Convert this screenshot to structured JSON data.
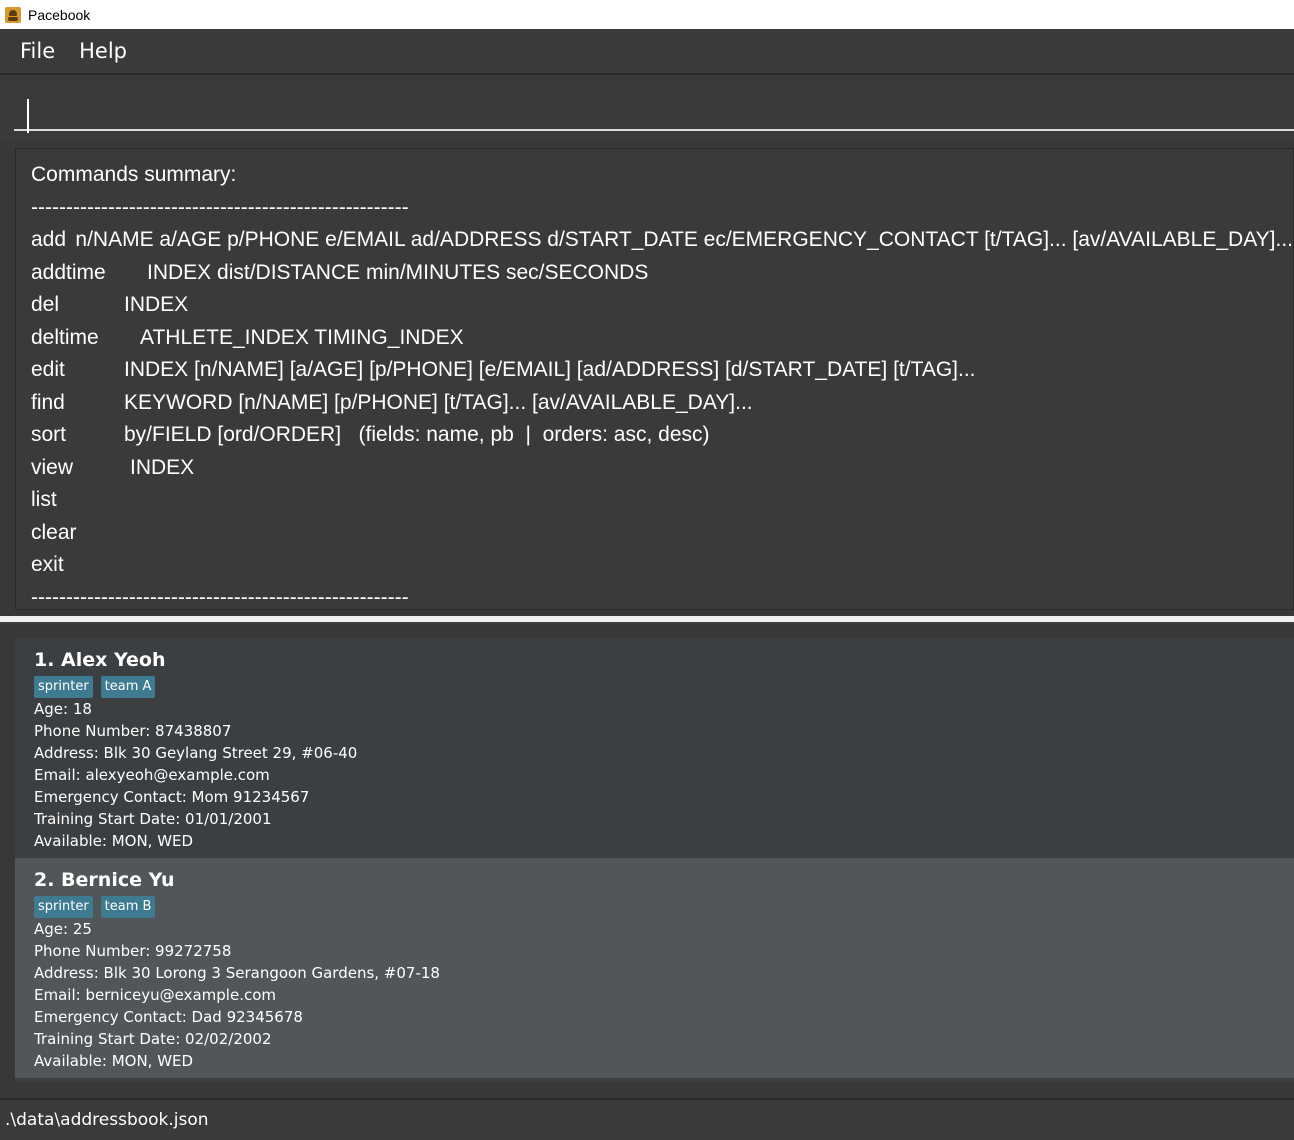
{
  "window": {
    "title": "Pacebook"
  },
  "menu": {
    "file": "File",
    "help": "Help"
  },
  "command_box": {
    "value": "",
    "placeholder": ""
  },
  "result": {
    "heading": "Commands summary:",
    "separator": "------------------------------------------------------",
    "commands": [
      {
        "cmd": "add",
        "args": "n/NAME a/AGE p/PHONE e/EMAIL ad/ADDRESS d/START_DATE ec/EMERGENCY_CONTACT [t/TAG]... [av/AVAILABLE_DAY]..."
      },
      {
        "cmd": "addtime",
        "args": "INDEX dist/DISTANCE min/MINUTES sec/SECONDS"
      },
      {
        "cmd": "del",
        "args": "INDEX"
      },
      {
        "cmd": "deltime",
        "args": "ATHLETE_INDEX TIMING_INDEX"
      },
      {
        "cmd": "edit",
        "args": "INDEX [n/NAME] [a/AGE] [p/PHONE] [e/EMAIL] [ad/ADDRESS] [d/START_DATE] [t/TAG]..."
      },
      {
        "cmd": "find",
        "args": "KEYWORD [n/NAME] [p/PHONE] [t/TAG]... [av/AVAILABLE_DAY]..."
      },
      {
        "cmd": "sort",
        "args": "by/FIELD [ord/ORDER]   (fields: name, pb  |  orders: asc, desc)"
      },
      {
        "cmd": "view",
        "args": "INDEX"
      },
      {
        "cmd": "list",
        "args": ""
      },
      {
        "cmd": "clear",
        "args": ""
      },
      {
        "cmd": "exit",
        "args": ""
      }
    ]
  },
  "persons": [
    {
      "name": "1. Alex Yeoh",
      "tags": [
        "sprinter",
        "team A"
      ],
      "age": "Age: 18",
      "phone": "Phone Number: 87438807",
      "address": "Address: Blk 30 Geylang Street 29, #06-40",
      "email": "Email: alexyeoh@example.com",
      "emergency": "Emergency Contact: Mom 91234567",
      "start": "Training Start Date: 01/01/2001",
      "available": "Available: MON, WED"
    },
    {
      "name": "2. Bernice Yu",
      "tags": [
        "sprinter",
        "team B"
      ],
      "age": "Age: 25",
      "phone": "Phone Number: 99272758",
      "address": "Address: Blk 30 Lorong 3 Serangoon Gardens, #07-18",
      "email": "Email: berniceyu@example.com",
      "emergency": "Emergency Contact: Dad 92345678",
      "start": "Training Start Date: 02/02/2002",
      "available": "Available: MON, WED"
    }
  ],
  "status": {
    "file_path": ".\\data\\addressbook.json"
  },
  "colors": {
    "tag_bg": "#3e7b91",
    "card_alt_bg": "#515658",
    "panel_bg": "#3a3a3a"
  }
}
